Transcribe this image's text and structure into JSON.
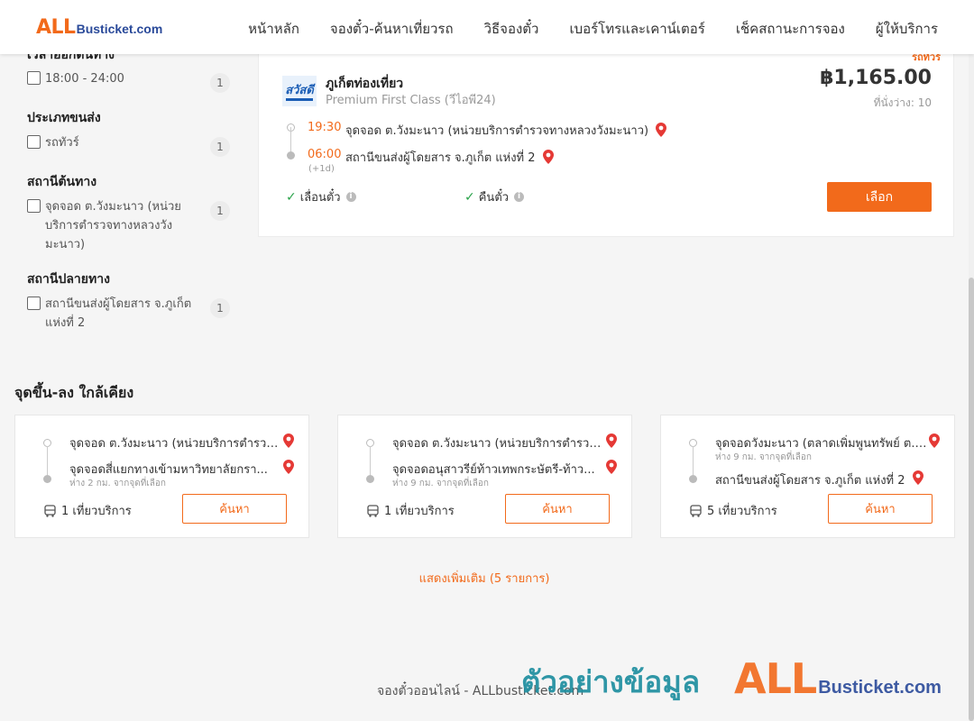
{
  "header": {
    "logo_main": "ALL",
    "logo_sub": "Busticket.com",
    "nav": [
      "หน้าหลัก",
      "จองตั๋ว-ค้นหาเที่ยวรถ",
      "วิธีจองตั๋ว",
      "เบอร์โทรและเคาน์เตอร์",
      "เช็คสถานะการจอง",
      "ผู้ให้บริการ"
    ]
  },
  "filters": {
    "cut_title": "เวลาออกต้นทาง",
    "time": {
      "label": "18:00 - 24:00",
      "count": "1"
    },
    "vehicle": {
      "title": "ประเภทขนส่ง",
      "label": "รถทัวร์",
      "count": "1"
    },
    "origin": {
      "title": "สถานีต้นทาง",
      "label": "จุดจอด ต.วังมะนาว (หน่วยบริการตำรวจทางหลวงวังมะนาว)",
      "count": "1"
    },
    "destination": {
      "title": "สถานีปลายทาง",
      "label": "สถานีขนส่งผู้โดยสาร จ.ภูเก็ต แห่งที่ 2",
      "count": "1"
    }
  },
  "trip": {
    "tag": "รถทัวร์",
    "operator_logo_text": "สวัสดี",
    "operator": "ภูเก็ตท่องเที่ยว",
    "bus_class": "Premium First Class (วีไอพี24)",
    "price": "฿1,165.00",
    "seats": "ที่นั่งว่าง: 10",
    "depart_time": "19:30",
    "depart_place": "จุดจอด ต.วังมะนาว (หน่วยบริการตำรวจทางหลวงวังมะนาว)",
    "arrive_time": "06:00",
    "arrive_place": "สถานีขนส่งผู้โดยสาร จ.ภูเก็ต แห่งที่ 2",
    "next_day": "(+1d)",
    "feature_1": "เลื่อนตั๋ว",
    "feature_2": "คืนตั๋ว",
    "select_label": "เลือก"
  },
  "nearby": {
    "title": "จุดขึ้น-ลง ใกล้เคียง",
    "cards": [
      {
        "from": "จุดจอด ต.วังมะนาว (หน่วยบริการตำรวจทางหลวงวังมะนาว)",
        "to": "จุดจอดสี่แยกทางเข้ามหาวิทยาลัยกรา...",
        "distance": "ห่าง 2 กม. จากจุดที่เลือก",
        "trips": "1 เที่ยวบริการ",
        "button": "ค้นหา"
      },
      {
        "from": "จุดจอด ต.วังมะนาว (หน่วยบริการตำรวจทางหลวงวังมะนาว)",
        "to": "จุดจอดอนุสาวรีย์ท้าวเทพกระษัตรี-ท้าว...",
        "distance": "ห่าง 9 กม. จากจุดที่เลือก",
        "trips": "1 เที่ยวบริการ",
        "button": "ค้นหา"
      },
      {
        "from": "จุดจอดวังมะนาว (ตลาดเพิ่มพูนทรัพย์ ต.วังมะนาว)",
        "distance": "ห่าง 9 กม. จากจุดที่เลือก",
        "to": "สถานีขนส่งผู้โดยสาร จ.ภูเก็ต แห่งที่ 2",
        "trips": "5 เที่ยวบริการ",
        "button": "ค้นหา"
      }
    ]
  },
  "show_more": "แสดงเพิ่มเติม (5 รายการ)",
  "footer": "จองตั๋วออนไลน์ - ALLbusticket.com",
  "watermark": {
    "text": "ตัวอย่างข้อมูล",
    "logo_main": "ALL",
    "logo_sub": "Busticket.com"
  },
  "colors": {
    "accent": "#f26a1b",
    "pin": "#e53935",
    "check": "#2aa34a",
    "watermark": "#1f8fa0"
  }
}
